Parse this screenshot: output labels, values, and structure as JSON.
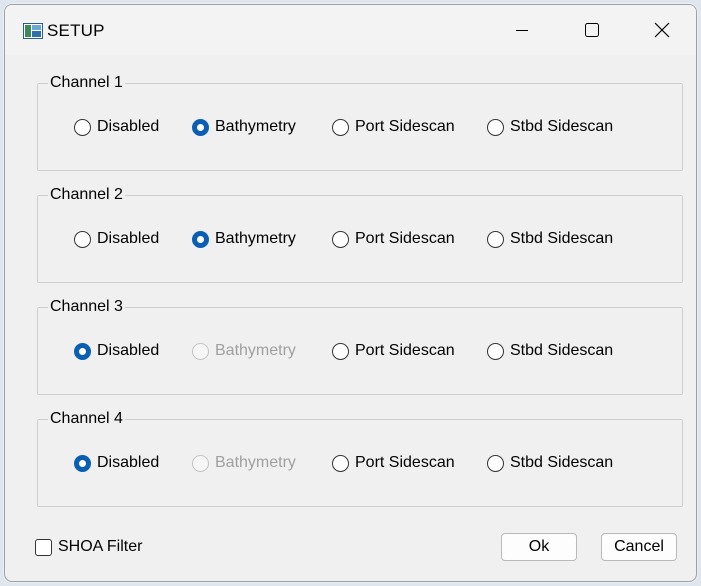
{
  "window": {
    "title": "SETUP",
    "app_icon": "app-window-icon",
    "controls": {
      "minimize_icon": "minimize-icon",
      "maximize_icon": "maximize-icon",
      "close_icon": "close-icon"
    }
  },
  "colors": {
    "accent": "#0a5fb5",
    "dialog_bg": "#f0f0f0",
    "disabled_text": "#a0a0a0"
  },
  "channels": [
    {
      "label": "Channel 1",
      "options": [
        {
          "label": "Disabled",
          "checked": false,
          "enabled": true
        },
        {
          "label": "Bathymetry",
          "checked": true,
          "enabled": true
        },
        {
          "label": "Port Sidescan",
          "checked": false,
          "enabled": true
        },
        {
          "label": "Stbd Sidescan",
          "checked": false,
          "enabled": true
        }
      ]
    },
    {
      "label": "Channel 2",
      "options": [
        {
          "label": "Disabled",
          "checked": false,
          "enabled": true
        },
        {
          "label": "Bathymetry",
          "checked": true,
          "enabled": true
        },
        {
          "label": "Port Sidescan",
          "checked": false,
          "enabled": true
        },
        {
          "label": "Stbd Sidescan",
          "checked": false,
          "enabled": true
        }
      ]
    },
    {
      "label": "Channel 3",
      "options": [
        {
          "label": "Disabled",
          "checked": true,
          "enabled": true
        },
        {
          "label": "Bathymetry",
          "checked": false,
          "enabled": false
        },
        {
          "label": "Port Sidescan",
          "checked": false,
          "enabled": true
        },
        {
          "label": "Stbd Sidescan",
          "checked": false,
          "enabled": true
        }
      ]
    },
    {
      "label": "Channel 4",
      "options": [
        {
          "label": "Disabled",
          "checked": true,
          "enabled": true
        },
        {
          "label": "Bathymetry",
          "checked": false,
          "enabled": false
        },
        {
          "label": "Port Sidescan",
          "checked": false,
          "enabled": true
        },
        {
          "label": "Stbd Sidescan",
          "checked": false,
          "enabled": true
        }
      ]
    }
  ],
  "shoa_filter": {
    "label": "SHOA Filter",
    "checked": false
  },
  "buttons": {
    "ok_label": "Ok",
    "cancel_label": "Cancel"
  }
}
